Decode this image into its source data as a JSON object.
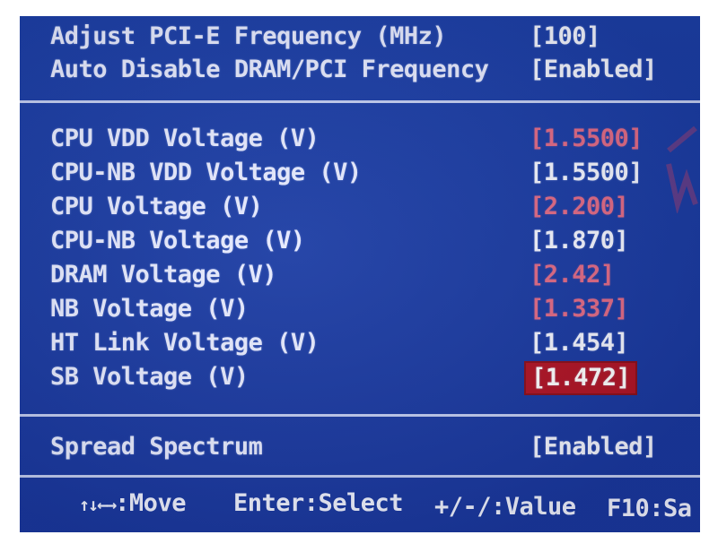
{
  "top_settings": [
    {
      "label": "Adjust PCI-E Frequency (MHz)",
      "value": "[100]"
    },
    {
      "label": "Auto Disable DRAM/PCI Frequency",
      "value": "[Enabled]"
    }
  ],
  "voltages": [
    {
      "label": "CPU VDD Voltage (V)",
      "value": "[1.5500]",
      "state": "warning"
    },
    {
      "label": "CPU-NB VDD Voltage (V)",
      "value": "[1.5500]",
      "state": "normal"
    },
    {
      "label": "CPU Voltage (V)",
      "value": "[2.200]",
      "state": "warning"
    },
    {
      "label": "CPU-NB Voltage (V)",
      "value": "[1.870]",
      "state": "normal"
    },
    {
      "label": "DRAM Voltage (V)",
      "value": "[2.42]",
      "state": "warning"
    },
    {
      "label": "NB Voltage (V)",
      "value": "[1.337]",
      "state": "warning"
    },
    {
      "label": "HT Link Voltage (V)",
      "value": "[1.454]",
      "state": "normal"
    },
    {
      "label": "SB Voltage (V)",
      "value": "[1.472]",
      "state": "selected"
    }
  ],
  "spread_spectrum": {
    "label": "Spread Spectrum",
    "value": "[Enabled]"
  },
  "help": {
    "move_keys": "↑↓←→",
    "move": ":Move",
    "enter": "Enter:Select",
    "value": "+/-/:Value",
    "save": "F10:Sa"
  },
  "colors": {
    "background": "#1a3ba3",
    "text": "#e6eaff",
    "warning": "#e06a86",
    "selected_bg": "#b01426"
  }
}
